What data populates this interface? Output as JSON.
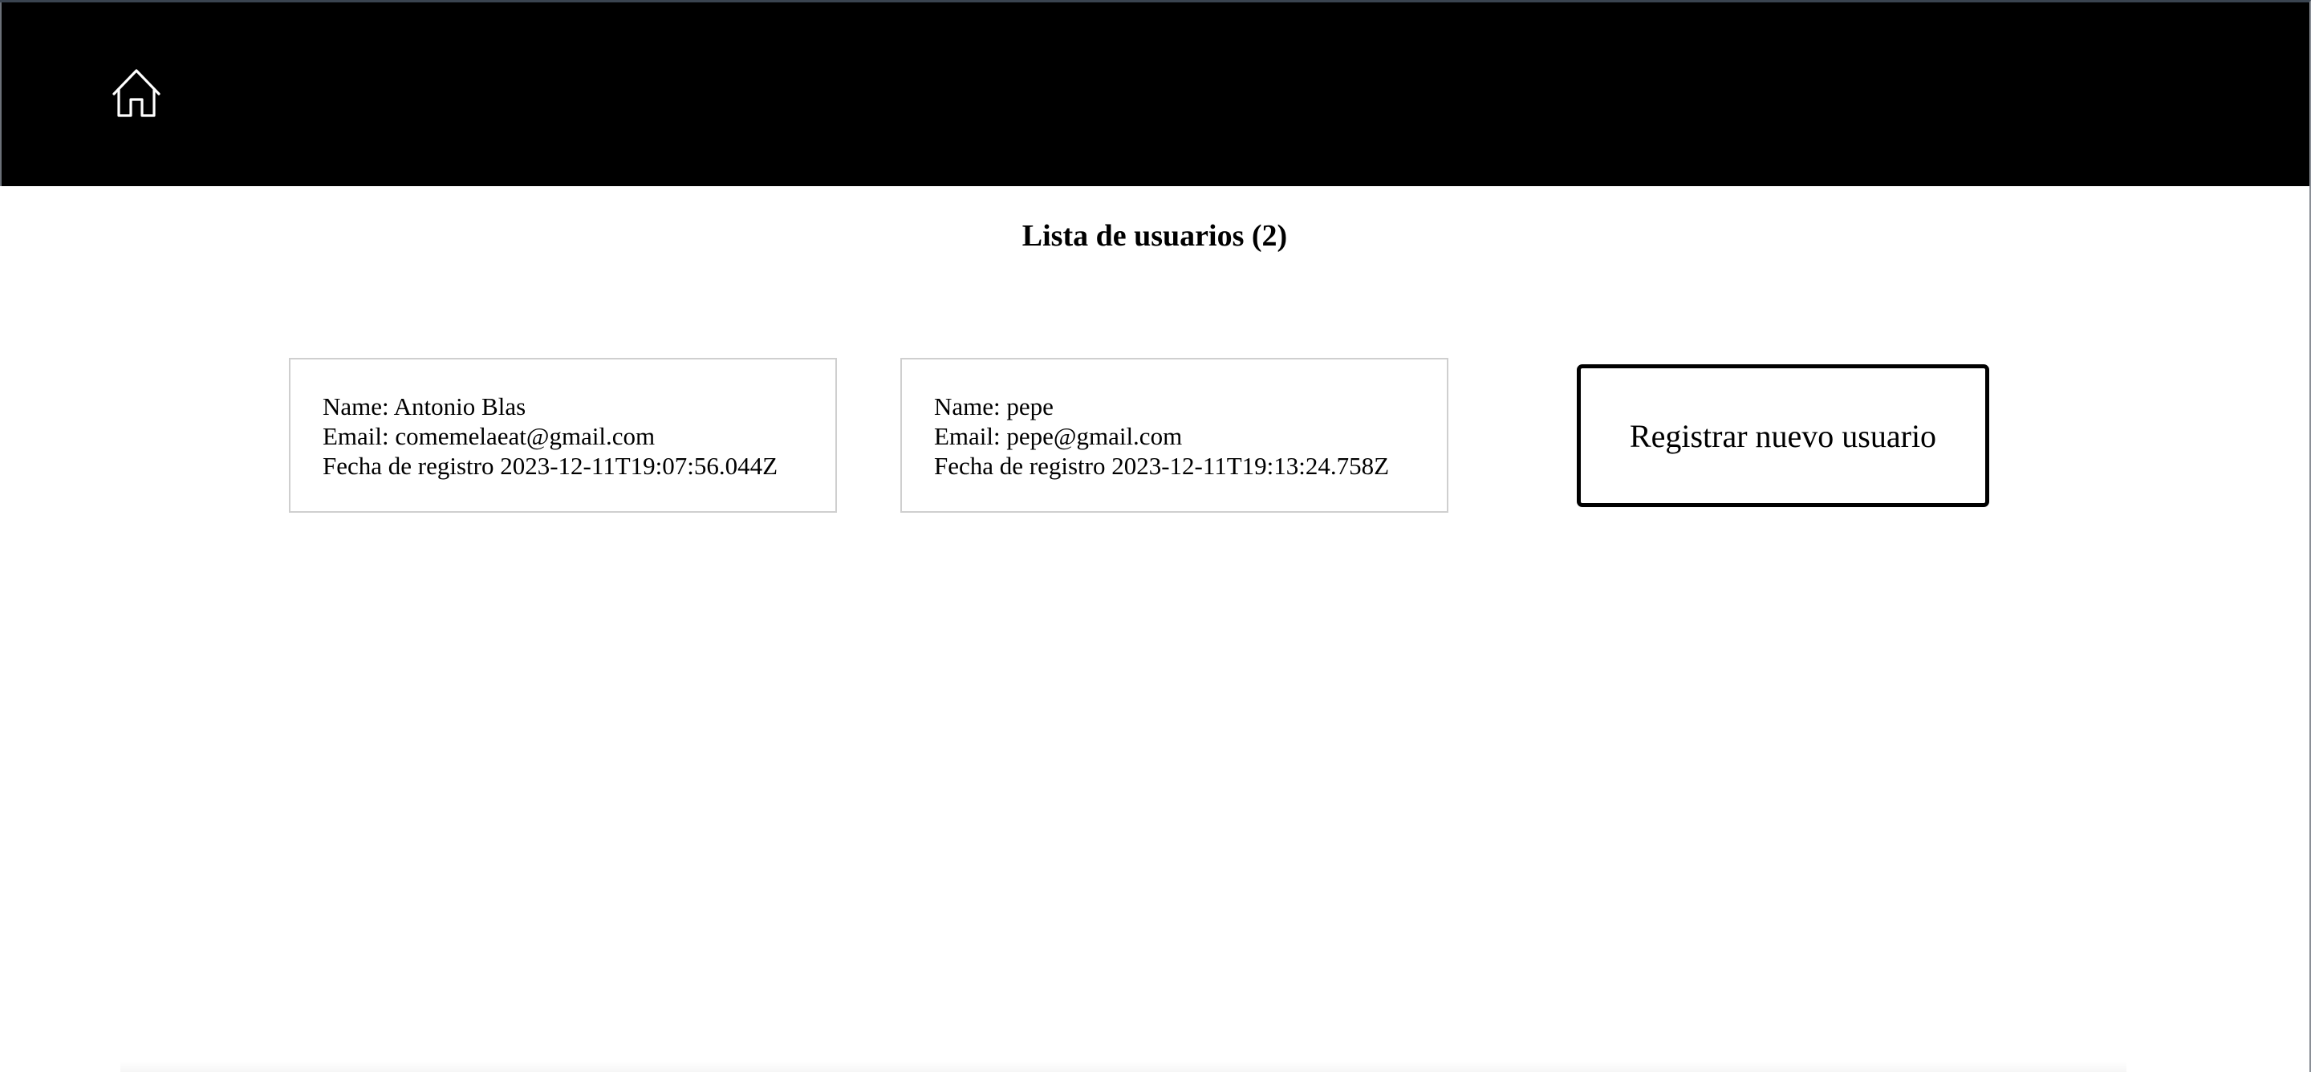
{
  "header": {
    "home_icon": "home-icon"
  },
  "main": {
    "title": "Lista de usuarios (2)",
    "users": [
      {
        "name_line": "Name: Antonio Blas",
        "email_line": "Email: comemelaeat@gmail.com",
        "date_line": "Fecha de registro 2023-12-11T19:07:56.044Z"
      },
      {
        "name_line": "Name: pepe",
        "email_line": "Email: pepe@gmail.com",
        "date_line": "Fecha de registro 2023-12-11T19:13:24.758Z"
      }
    ],
    "register_button_label": "Registrar nuevo usuario"
  },
  "colors": {
    "header_background": "#000000",
    "page_background": "#ffffff",
    "card_border": "#cfcfcf",
    "button_border": "#000000"
  }
}
